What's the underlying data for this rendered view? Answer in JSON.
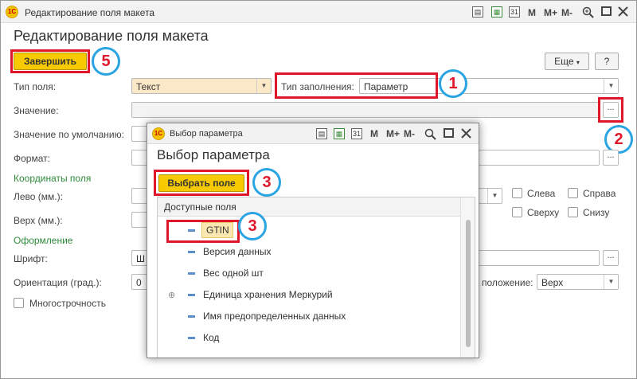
{
  "window": {
    "title": "Редактирование поля макета",
    "toolbar": {
      "m": "M",
      "mplus": "M+",
      "mminus": "M-"
    }
  },
  "form": {
    "heading": "Редактирование поля макета",
    "finish_button": "Завершить",
    "more_button": "Еще",
    "help_button": "?",
    "field_type_label": "Тип поля:",
    "field_type_value": "Текст",
    "fill_type_label": "Тип заполнения:",
    "fill_type_value": "Параметр",
    "value_label": "Значение:",
    "default_label": "Значение по умолчанию:",
    "format_label": "Формат:",
    "coords_section": "Координаты поля",
    "left_label": "Лево (мм.):",
    "top_label": "Верх (мм.):",
    "cb_left": "Слева",
    "cb_right": "Справа",
    "cb_top": "Сверху",
    "cb_bottom": "Снизу",
    "design_section": "Оформление",
    "font_label": "Шрифт:",
    "font_value": "Ш",
    "orientation_label": "Ориентация (град.):",
    "orientation_value": "0",
    "position_label": "положение:",
    "position_value": "Верх",
    "multiline_label": "Многострочность",
    "dots": "..."
  },
  "dialog": {
    "title": "Выбор параметра",
    "heading": "Выбор параметра",
    "select_button": "Выбрать поле",
    "list_header": "Доступные поля",
    "items": [
      {
        "label": "GTIN",
        "selected": true
      },
      {
        "label": "Версия данных"
      },
      {
        "label": "Вес одной шт"
      },
      {
        "label": "Единица хранения Меркурий",
        "expandable": true
      },
      {
        "label": "Имя предопределенных данных"
      },
      {
        "label": "Код"
      }
    ]
  },
  "annotations": {
    "n1": "1",
    "n2": "2",
    "n3": "3",
    "n3b": "3",
    "n5": "5"
  },
  "colors": {
    "accent_yellow": "#f6c900",
    "annotation_red": "#e0162b",
    "annotation_blue": "#2aa4e2",
    "section_green": "#2e8b3a"
  }
}
